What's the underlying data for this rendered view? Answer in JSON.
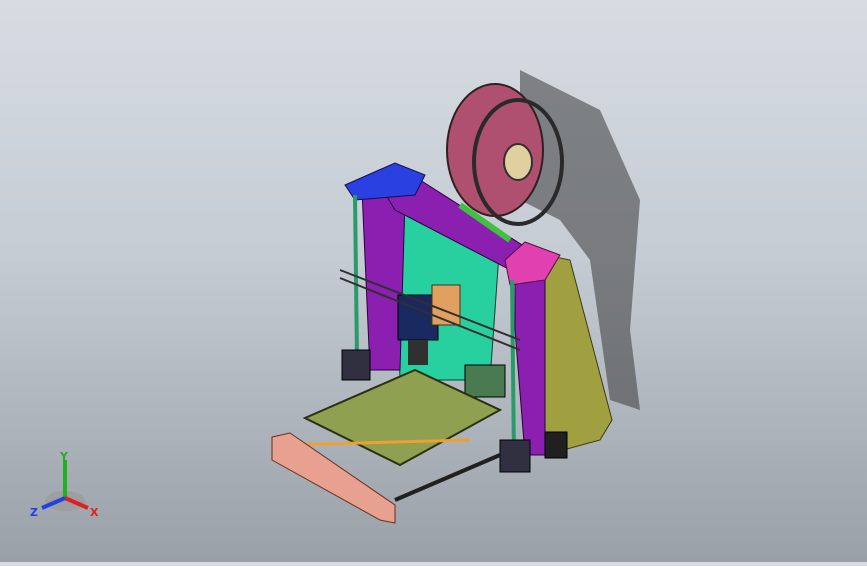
{
  "triad": {
    "x_label": "X",
    "y_label": "Y",
    "z_label": "Z",
    "x_color": "#e02020",
    "y_color": "#20b020",
    "z_color": "#2040e0"
  },
  "model": {
    "frame_color": "#8a1fb0",
    "left_plate_color": "#28d0a0",
    "right_plate_color": "#a0a040",
    "bed_color": "#8fa050",
    "top_left_corner_color": "#2a40e0",
    "top_right_corner_color": "#e040b0",
    "spool_color": "#b05070",
    "front_plate_color": "#e8a090"
  }
}
